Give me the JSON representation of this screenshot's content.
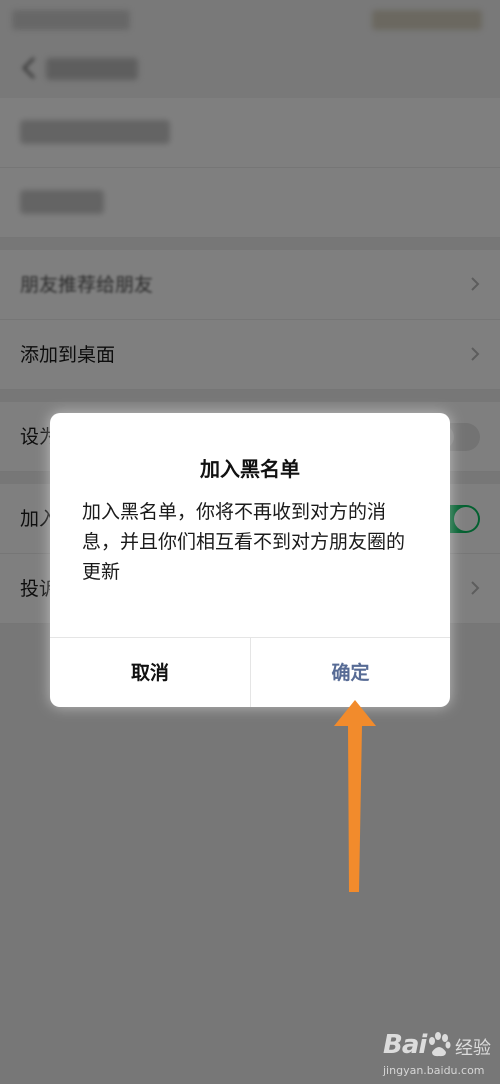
{
  "settings": {
    "rows": [
      {
        "label": "朋友推荐给朋友"
      },
      {
        "label": "添加到桌面"
      },
      {
        "label": "设为星标朋友"
      },
      {
        "label": "加入黑名单"
      },
      {
        "label": "投诉"
      }
    ]
  },
  "dialog": {
    "title": "加入黑名单",
    "message": "加入黑名单，你将不再收到对方的消息，并且你们相互看不到对方朋友圈的更新",
    "cancel_label": "取消",
    "confirm_label": "确定"
  },
  "colors": {
    "confirm_text": "#576b95",
    "arrow": "#f28b2c",
    "toggle_on": "#07c160"
  },
  "watermark": {
    "logo": "Bai",
    "logo_suffix": "经验",
    "url": "jingyan.baidu.com"
  }
}
